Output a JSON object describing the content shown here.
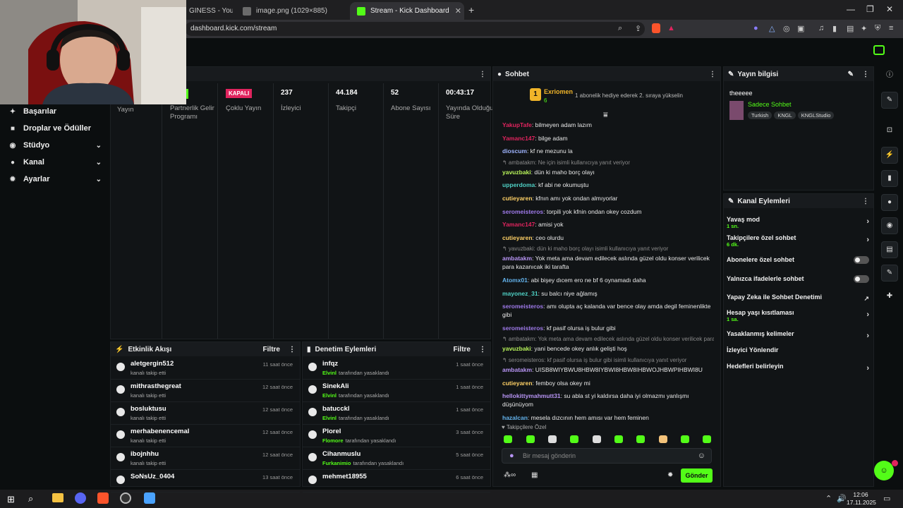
{
  "browser": {
    "tabs": [
      {
        "label": "GINESS - YouTube"
      },
      {
        "label": "image.png (1029×885)"
      },
      {
        "label": "Stream - Kick Dashboard"
      }
    ],
    "url": "dashboard.kick.com/stream",
    "new_tab": "+",
    "window_controls": [
      "—",
      "❐",
      "✕"
    ]
  },
  "sidebar": {
    "items": [
      {
        "label": "Başarılar",
        "icon": "trophy-icon",
        "glyph": "🏆"
      },
      {
        "label": "Droplar ve Ödüller",
        "icon": "gift-icon",
        "glyph": "🎁"
      },
      {
        "label": "Stüdyo",
        "icon": "studio-icon",
        "glyph": "⚙"
      },
      {
        "label": "Kanal",
        "icon": "user-icon",
        "glyph": "👤"
      },
      {
        "label": "Ayarlar",
        "icon": "gear-icon",
        "glyph": "⚙"
      }
    ]
  },
  "stats": [
    {
      "value": "",
      "label": "Yayın"
    },
    {
      "value": "",
      "label": "Partnerlik Gelir Programı"
    },
    {
      "value": "KAPALI",
      "label": "Çoklu Yayın"
    },
    {
      "value": "237",
      "label": "İzleyici"
    },
    {
      "value": "44.184",
      "label": "Takipçi"
    },
    {
      "value": "52",
      "label": "Abone Sayısı"
    },
    {
      "value": "00:43:17",
      "label": "Yayında Olduğu Süre"
    }
  ],
  "activity": {
    "title": "Etkinlik Akışı",
    "filter": "Filtre",
    "items": [
      {
        "name": "aletgergin512",
        "sub": "kanalı takip etti",
        "time": "11 saat önce"
      },
      {
        "name": "mithrasthegreat",
        "sub": "kanalı takip etti",
        "time": "12 saat önce"
      },
      {
        "name": "bosluktusu",
        "sub": "kanalı takip etti",
        "time": "12 saat önce"
      },
      {
        "name": "merhabenencemal",
        "sub": "kanalı takip etti",
        "time": "12 saat önce"
      },
      {
        "name": "ibojnhhu",
        "sub": "kanalı takip etti",
        "time": "12 saat önce"
      },
      {
        "name": "SoNsUz_0404",
        "sub": "",
        "time": "13 saat önce"
      }
    ]
  },
  "moderation": {
    "title": "Denetim Eylemleri",
    "filter": "Filtre",
    "items": [
      {
        "name": "infqz",
        "mod": "Elvinl",
        "sub": "tarafından yasaklandı",
        "time": "1 saat önce"
      },
      {
        "name": "SinekAli",
        "mod": "Elvinl",
        "sub": "tarafından yasaklandı",
        "time": "1 saat önce"
      },
      {
        "name": "batucckl",
        "mod": "Elvinl",
        "sub": "tarafından yasaklandı",
        "time": "1 saat önce"
      },
      {
        "name": "Plorel",
        "mod": "Flomore",
        "sub": "tarafından yasaklandı",
        "time": "3 saat önce"
      },
      {
        "name": "Cihanmuslu",
        "mod": "Furkanimio",
        "sub": "tarafından yasaklandı",
        "time": "5 saat önce"
      },
      {
        "name": "mehmet18955",
        "mod": "",
        "sub": "",
        "time": "6 saat önce"
      }
    ]
  },
  "chat": {
    "title": "Sohbet",
    "pinned_user": "Exriomen",
    "pinned_count": "6",
    "pinned_rank": "1",
    "pinned_text": "1 abonelik hediye ederek 2. sıraya yükselin",
    "messages": [
      {
        "type": "msg",
        "user": "YakupTafe",
        "color": "#e0245e",
        "text": ": bilmeyen adam lazım"
      },
      {
        "type": "msg",
        "user": "Yamanc147",
        "color": "#e0245e",
        "text": ": bilge adam"
      },
      {
        "type": "msg",
        "user": "dioscum",
        "color": "#9fb4ff",
        "text": ": kf ne mezunu la"
      },
      {
        "type": "reply",
        "text": "↰ ambatakm: Ne için isimli kullanıcıya yanıt veriyor"
      },
      {
        "type": "msg",
        "user": "yavuzbaki",
        "color": "#b7f35a",
        "text": ": dün ki maho borç olayı"
      },
      {
        "type": "msg",
        "user": "upperdoma",
        "color": "#4fd1c5",
        "text": ": kf abi ne okumuştu"
      },
      {
        "type": "msg",
        "user": "cutieyaren",
        "color": "#ffd166",
        "text": ": kfnın amı yok ondan almıyorlar"
      },
      {
        "type": "msg",
        "user": "seromeisteros",
        "color": "#9f7aea",
        "text": ": torpili yok kfnin ondan okey cozdum"
      },
      {
        "type": "msg",
        "user": "Yamanc147",
        "color": "#e0245e",
        "text": ": amisi yok"
      },
      {
        "type": "msg",
        "user": "cutieyaren",
        "color": "#ffd166",
        "text": ": ceo olurdu"
      },
      {
        "type": "reply",
        "text": "↰ yavuzbaki: dün ki maho borç olayı isimli kullanıcıya yanıt veriyor"
      },
      {
        "type": "msg",
        "user": "ambatakm",
        "color": "#b794f4",
        "text": ": Yok meta ama devam edilecek aslında güzel oldu konser verilicek para kazanıcak iki tarafta"
      },
      {
        "type": "msg",
        "user": "Atomx01",
        "color": "#63b3ed",
        "text": ": abi bişey dıcem ero ne bf 6 oynamadı daha"
      },
      {
        "type": "msg",
        "user": "mayonez_31",
        "color": "#4fd1c5",
        "text": ": su balcı niye ağlamış"
      },
      {
        "type": "msg",
        "user": "seromeisteros",
        "color": "#9f7aea",
        "text": ": amı olupta aç kalanda var bence olay amda degil feminenlikte gibi"
      },
      {
        "type": "msg",
        "user": "seromeisteros",
        "color": "#9f7aea",
        "text": ": kf pasif olursa iş bulur gibi"
      },
      {
        "type": "reply",
        "text": "↰ ambatakm: Yok meta ama devam edilecek aslında güzel oldu konser verilicek para..."
      },
      {
        "type": "msg",
        "user": "yavuzbaki",
        "color": "#b7f35a",
        "text": ": yani bencede okey anlık gelişti hoş"
      },
      {
        "type": "reply",
        "text": "↰ seromeisteros: kf pasif olursa iş bulur gibi isimli kullanıcıya yanıt veriyor"
      },
      {
        "type": "msg",
        "user": "ambatakm",
        "color": "#b794f4",
        "text": ": UISB8WIYBWU8HBW8IYBWI8HBW8IHBWOJHBWPIHBWI8U"
      },
      {
        "type": "msg",
        "user": "cutieyaren",
        "color": "#ffd166",
        "text": ": femboy olsa okey mi"
      },
      {
        "type": "msg",
        "user": "hellokittymahmutt31",
        "color": "#b794f4",
        "text": ": su abla st yi kaldırsa daha iyi olmazmı yanlışmı düşünüyom"
      },
      {
        "type": "msg",
        "user": "hazalcan",
        "color": "#63b3ed",
        "text": ": mesela dızcının hem amısı var hem feminen"
      }
    ],
    "follower_only": "Takipçilere Özel",
    "input_placeholder": "Bir mesaj gönderin",
    "send": "Gönder"
  },
  "stream_info": {
    "title": "Yayın bilgisi",
    "stream_title": "theeeee",
    "category": "Sadece Sohbet",
    "tags": [
      "Turkish",
      "KNGL",
      "KNGLStudio"
    ]
  },
  "channel_actions": {
    "title": "Kanal Eylemleri",
    "rows": [
      {
        "label": "Yavaş mod",
        "sub": "1 sn.",
        "control": "arrow"
      },
      {
        "label": "Takipçilere özel sohbet",
        "sub": "6 dk.",
        "control": "arrow"
      },
      {
        "label": "Abonelere özel sohbet",
        "sub": "",
        "control": "toggle"
      },
      {
        "label": "Yalnızca ifadelerle sohbet",
        "sub": "",
        "control": "toggle"
      },
      {
        "label": "Yapay Zeka ile Sohbet Denetimi",
        "sub": "",
        "control": "external"
      },
      {
        "label": "Hesap yaşı kısıtlaması",
        "sub": "1 sa.",
        "control": "arrow"
      },
      {
        "label": "Yasaklanmış kelimeler",
        "sub": "",
        "control": "arrow"
      },
      {
        "label": "İzleyici Yönlendir",
        "sub": "",
        "control": "none"
      },
      {
        "label": "Hedefleri belirleyin",
        "sub": "",
        "control": "arrow"
      }
    ]
  },
  "taskbar": {
    "time": "12:06",
    "date": "17.11.2025"
  },
  "colors": {
    "accent": "#53fc18",
    "live_badge": "#e0245e"
  }
}
